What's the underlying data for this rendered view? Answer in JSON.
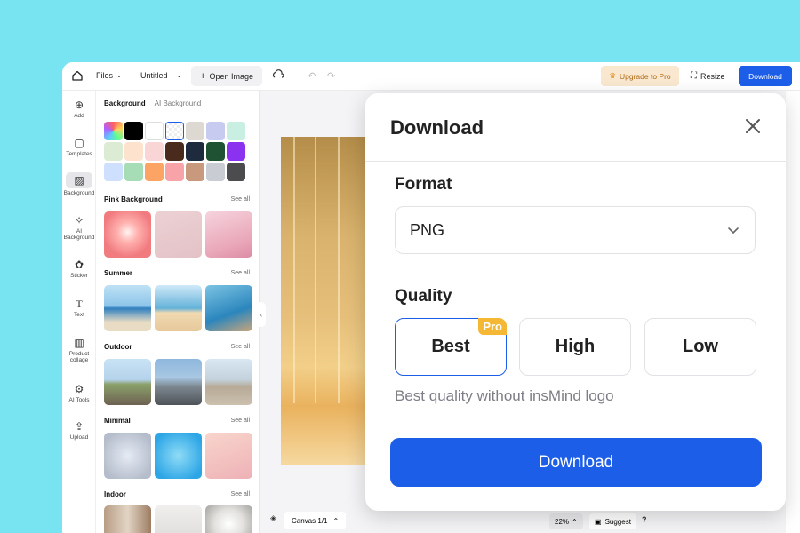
{
  "topbar": {
    "files": "Files",
    "doc_title": "Untitled",
    "open_image": "Open Image",
    "upgrade": "Upgrade to Pro",
    "resize": "Resize",
    "download": "Download"
  },
  "rail": {
    "items": [
      {
        "label": "Add",
        "icon": "plus-circle-icon"
      },
      {
        "label": "Templates",
        "icon": "templates-icon"
      },
      {
        "label": "Background",
        "icon": "background-icon"
      },
      {
        "label": "AI Background",
        "icon": "ai-sparkle-icon"
      },
      {
        "label": "Sticker",
        "icon": "sticker-icon"
      },
      {
        "label": "Text",
        "icon": "text-icon"
      },
      {
        "label": "Product collage",
        "icon": "collage-icon"
      },
      {
        "label": "AI Tools",
        "icon": "ai-tools-icon"
      },
      {
        "label": "Upload",
        "icon": "upload-icon"
      }
    ],
    "active_index": 2
  },
  "panel": {
    "tab_background": "Background",
    "tab_ai_background": "AI Background",
    "swatch_colors": [
      "#ff6b6b",
      "#000000",
      "#ffffff",
      "#f3f3f3",
      "#ddd8d2",
      "#c8cbf0",
      "#c9efe3",
      "#dcebd3",
      "#fde2cd",
      "#f9d5d5",
      "#4a2a1d",
      "#1e2a3e",
      "#1f5133",
      "#8b32f0",
      "#cfe0ff",
      "#a6ddb6",
      "#fba463",
      "#f7a3a8",
      "#c8997d",
      "#c9ccd3",
      "#4c4c4f"
    ],
    "see_all": "See all",
    "sections": [
      {
        "title": "Pink Background"
      },
      {
        "title": "Summer"
      },
      {
        "title": "Outdoor"
      },
      {
        "title": "Minimal"
      },
      {
        "title": "Indoor"
      }
    ]
  },
  "canvas": {
    "indicator": "Canvas 1/1",
    "zoom": "22%",
    "suggest": "Suggest",
    "help": "?"
  },
  "dialog": {
    "title": "Download",
    "format_label": "Format",
    "format_value": "PNG",
    "quality_label": "Quality",
    "quality_options": [
      "Best",
      "High",
      "Low"
    ],
    "selected_quality": "Best",
    "pro_badge": "Pro",
    "hint": "Best quality without insMind logo",
    "download_button": "Download"
  },
  "colors": {
    "accent": "#1c5ee8",
    "pro_badge": "#f4b834",
    "backdrop": "#78e4f1"
  }
}
